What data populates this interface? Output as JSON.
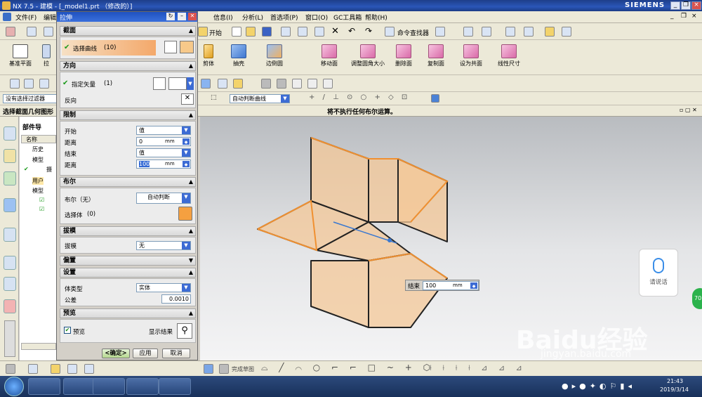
{
  "app": {
    "title": "NX 7.5 - 建模 - [_model1.prt （修改的）]",
    "brand": "SIEMENS"
  },
  "menubar": {
    "items": [
      "文件(F)",
      "编辑",
      "信息(I)",
      "分析(L)",
      "首选项(P)",
      "窗口(O)",
      "GC工具箱",
      "帮助(H)"
    ]
  },
  "toolbar1": {
    "start_label": "开始",
    "command_finder": "命令查找器"
  },
  "toolbar2": {
    "datum_plane": "基准平面",
    "pull": "拉",
    "buttons": [
      "剪体",
      "抽壳",
      "边倒圆",
      "移动面",
      "调整圆角大小",
      "删除面",
      "复制面",
      "设为共面",
      "线性尺寸"
    ]
  },
  "selection_bar": {
    "filter_value": "没有选择过滤器",
    "curve_rule": "自动判断曲线"
  },
  "statusline": {
    "prompt": "选择截面几何图形",
    "message": "将不执行任何布尔运算。"
  },
  "navigator": {
    "title": "部件导",
    "col_name": "名称",
    "items": [
      "历史",
      "模型",
      "摄",
      "用户",
      "模型"
    ]
  },
  "dialog": {
    "title": "拉伸",
    "section": {
      "header": "截面",
      "select_curve": "选择曲线",
      "count": "(10)"
    },
    "direction": {
      "header": "方向",
      "specify_vector": "指定矢量",
      "count": "(1)",
      "reverse": "反向"
    },
    "limits": {
      "header": "限制",
      "start_label": "开始",
      "start_value": "值",
      "dist1_label": "距离",
      "dist1_value": "0",
      "dist1_unit": "mm",
      "end_label": "结束",
      "end_value": "值",
      "dist2_label": "距离",
      "dist2_value": "100",
      "dist2_unit": "mm"
    },
    "boolean": {
      "header": "布尔",
      "bool_label": "布尔（无）",
      "bool_value": "自动判断",
      "select_body": "选择体",
      "count": "(0)"
    },
    "draft": {
      "header": "拔模",
      "label": "拔模",
      "value": "无"
    },
    "offset": {
      "header": "偏置"
    },
    "settings": {
      "header": "设置",
      "body_type_label": "体类型",
      "body_type_value": "实体",
      "tolerance_label": "公差",
      "tolerance_value": "0.0010"
    },
    "preview": {
      "header": "预览",
      "checkbox_label": "预览",
      "show_result": "显示结果"
    },
    "buttons": {
      "ok": "<确定>",
      "apply": "应用",
      "cancel": "取消"
    }
  },
  "viewport_end_field": {
    "label": "结束",
    "value": "100",
    "unit": "mm"
  },
  "bottom_toolbar": {
    "finish_sketch": "完成草图"
  },
  "voice_widget": {
    "label": "请说话"
  },
  "watermark": {
    "text": "Baidu经验",
    "url": "jingyan.baidu.com"
  },
  "taskbar": {
    "time": "21:43",
    "date": "2019/3/14"
  },
  "badge": {
    "value": "70"
  }
}
